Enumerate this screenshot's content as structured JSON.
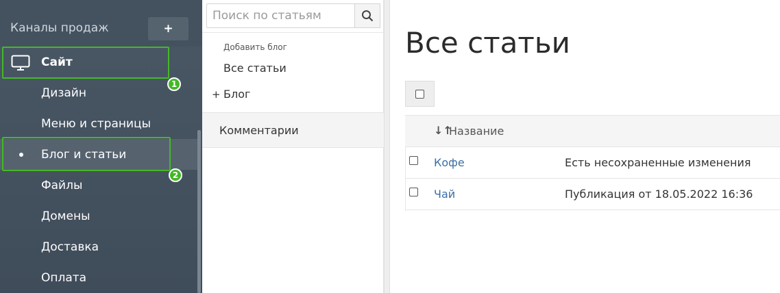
{
  "sidebar": {
    "header_label": "Каналы продаж",
    "add_label": "+",
    "items": [
      {
        "label": "Сайт",
        "icon": "monitor-icon"
      },
      {
        "label": "Дизайн"
      },
      {
        "label": "Меню и страницы"
      },
      {
        "label": "Блог и статьи",
        "active": true
      },
      {
        "label": "Файлы"
      },
      {
        "label": "Домены"
      },
      {
        "label": "Доставка"
      },
      {
        "label": "Оплата"
      }
    ]
  },
  "annotations": {
    "badge_1": "1",
    "badge_2": "2",
    "color": "#44b826"
  },
  "middle": {
    "search_placeholder": "Поиск по статьям",
    "add_blog": "Добавить блог",
    "all_articles": "Все статьи",
    "blog_plus": "+",
    "blog": "Блог",
    "comments": "Комментарии"
  },
  "main": {
    "title": "Все статьи",
    "column_name": "Название",
    "rows": [
      {
        "title": "Кофе",
        "status": "Есть несохраненные изменения"
      },
      {
        "title": "Чай",
        "status": "Публикация от 18.05.2022 16:36"
      }
    ],
    "link_color": "#3b6ea5"
  }
}
